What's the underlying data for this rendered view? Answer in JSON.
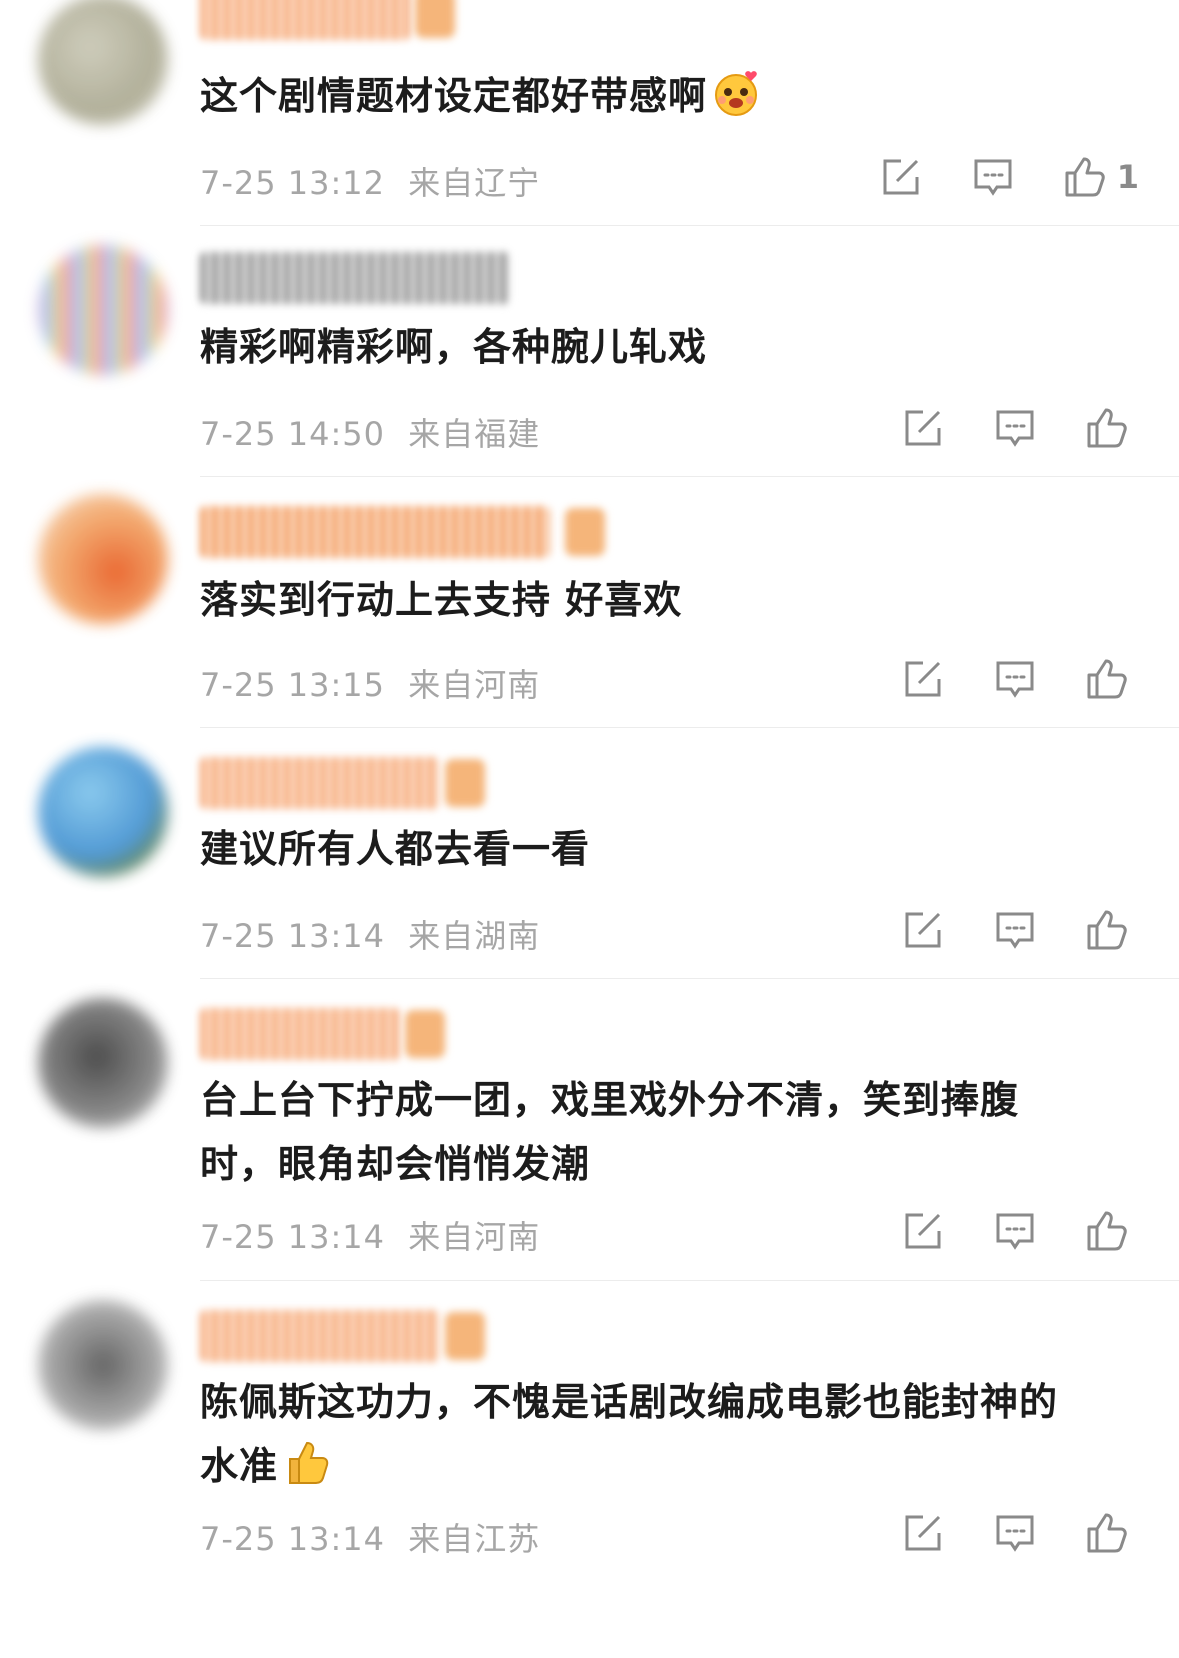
{
  "comments": [
    {
      "text": "这个剧情题材设定都好带感啊",
      "emoji": "love-face-emoji",
      "date": "7-25 13:12",
      "location": "来自辽宁",
      "likes": "1"
    },
    {
      "text": "精彩啊精彩啊，各种腕儿轧戏",
      "date": "7-25 14:50",
      "location": "来自福建",
      "likes": ""
    },
    {
      "text": "落实到行动上去支持 好喜欢",
      "date": "7-25 13:15",
      "location": "来自河南",
      "likes": ""
    },
    {
      "text": "建议所有人都去看一看",
      "date": "7-25 13:14",
      "location": "来自湖南",
      "likes": ""
    },
    {
      "text": "台上台下拧成一团，戏里戏外分不清，笑到捧腹时，眼角却会悄悄发潮",
      "date": "7-25 13:14",
      "location": "来自河南",
      "likes": ""
    },
    {
      "text": "陈佩斯这功力，不愧是话剧改编成电影也能封神的水准",
      "emoji": "thumbs-up-emoji",
      "date": "7-25 13:14",
      "location": "来自江苏",
      "likes": ""
    }
  ],
  "colors": {
    "text": "#1c1c1c",
    "meta": "#a6a6a6",
    "icon": "#8a8a8a",
    "name_orange": "#f29a5c",
    "name_gray": "#9a9a9a"
  }
}
